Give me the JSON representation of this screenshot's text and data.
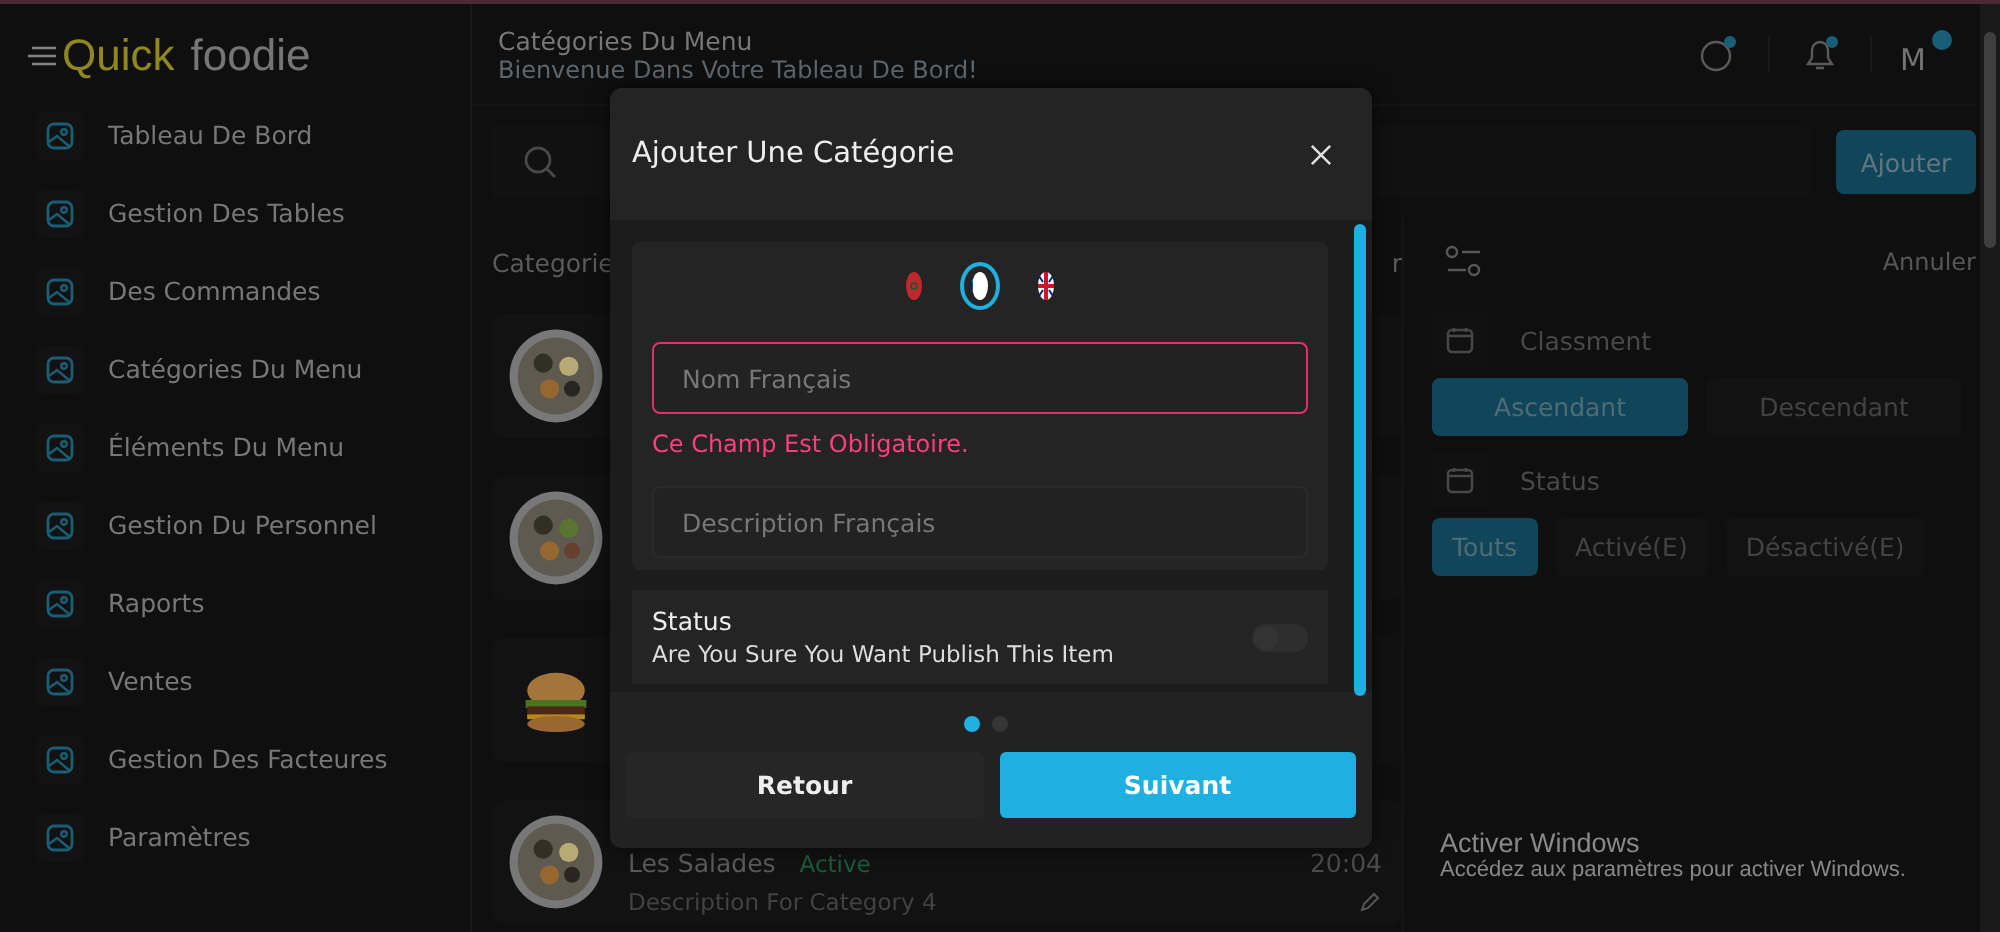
{
  "logo": {
    "first": "Quick",
    "second": "foodie"
  },
  "sidebar": {
    "items": [
      {
        "label": "Tableau De Bord"
      },
      {
        "label": "Gestion Des Tables"
      },
      {
        "label": "Des Commandes"
      },
      {
        "label": "Catégories Du Menu"
      },
      {
        "label": "Éléments Du Menu"
      },
      {
        "label": "Gestion Du Personnel"
      },
      {
        "label": "Raports"
      },
      {
        "label": "Ventes"
      },
      {
        "label": "Gestion Des Facteures"
      },
      {
        "label": "Paramètres"
      }
    ]
  },
  "header": {
    "title": "Catégories Du Menu",
    "subtitle": "Bienvenue Dans Votre Tableau De Bord!",
    "avatar": "M"
  },
  "toolbar": {
    "add_button": "Ajouter"
  },
  "list_header": {
    "label": "Categorie",
    "fragment": "r",
    "cancel": "Annuler"
  },
  "categories": [
    {
      "kind": "platter"
    },
    {
      "kind": "salad"
    },
    {
      "kind": "burger"
    },
    {
      "kind": "platter",
      "name": "Les Salades",
      "status": "Active",
      "time": "20:04",
      "description": "Description For Category 4"
    }
  ],
  "filters": {
    "sort_label": "Classment",
    "sort_options": [
      {
        "label": "Ascendant",
        "selected": true
      },
      {
        "label": "Descendant",
        "selected": false
      }
    ],
    "status_label": "Status",
    "status_options": [
      {
        "label": "Touts",
        "selected": true
      },
      {
        "label": "Activé(E)",
        "selected": false
      },
      {
        "label": "Désactivé(E)",
        "selected": false
      }
    ]
  },
  "modal": {
    "title": "Ajouter Une Catégorie",
    "languages": [
      {
        "kind": "ma",
        "selected": false
      },
      {
        "kind": "fr",
        "selected": true
      },
      {
        "kind": "gb",
        "selected": false
      }
    ],
    "name_field": {
      "placeholder": "Nom Français",
      "error": "Ce Champ Est Obligatoire."
    },
    "description_field": {
      "placeholder": "Description Français"
    },
    "status": {
      "title": "Status",
      "description": "Are You Sure You Want Publish This Item",
      "on": false
    },
    "steps": [
      {
        "selected": true
      },
      {
        "selected": false
      }
    ],
    "back_button": "Retour",
    "next_button": "Suivant"
  },
  "activation": {
    "title": "Activer Windows",
    "text": "Accédez aux paramètres pour activer Windows."
  }
}
